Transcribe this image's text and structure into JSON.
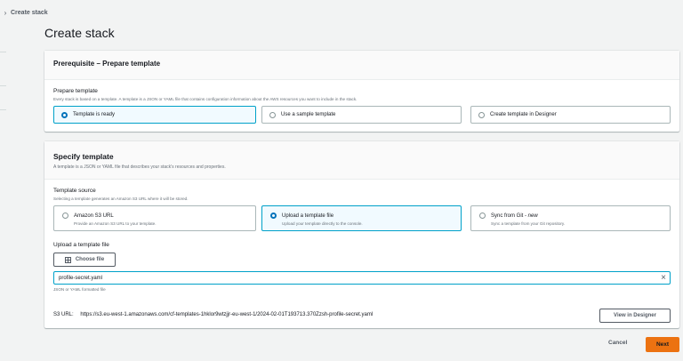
{
  "breadcrumb": {
    "current": "Create stack"
  },
  "page_title": "Create stack",
  "prerequisite": {
    "header": "Prerequisite – Prepare template",
    "field_label": "Prepare template",
    "field_desc": "Every stack is based on a template. A template is a JSON or YAML file that contains configuration information about the AWS resources you want to include in the stack.",
    "options": [
      {
        "label": "Template is ready",
        "selected": true
      },
      {
        "label": "Use a sample template",
        "selected": false
      },
      {
        "label": "Create template in Designer",
        "selected": false
      }
    ]
  },
  "specify": {
    "header": "Specify template",
    "header_desc": "A template is a JSON or YAML file that describes your stack's resources and properties.",
    "source_label": "Template source",
    "source_desc": "Selecting a template generates an Amazon S3 URL where it will be stored.",
    "sources": [
      {
        "label": "Amazon S3 URL",
        "desc": "Provide an Amazon S3 URL to your template.",
        "selected": false
      },
      {
        "label": "Upload a template file",
        "desc": "Upload your template directly to the console.",
        "selected": true
      },
      {
        "label": "Sync from Git - ",
        "label_em": "new",
        "desc": "Sync a template from your Git repository.",
        "selected": false
      }
    ],
    "upload_label": "Upload a template file",
    "choose_file": "Choose file",
    "file_name": "profile-secret.yaml",
    "file_hint": "JSON or YAML formatted file",
    "s3_label": "S3 URL:",
    "s3_url": "https://s3.eu-west-1.amazonaws.com/cf-templates-1hklor9wtzjjr-eu-west-1/2024-02-01T193713.370Zzsh-profile-secret.yaml",
    "view_designer": "View in Designer"
  },
  "footer": {
    "cancel": "Cancel",
    "next": "Next"
  },
  "colors": {
    "accent": "#ec7211",
    "selected_border": "#00a1c9",
    "radio": "#0073bb"
  }
}
